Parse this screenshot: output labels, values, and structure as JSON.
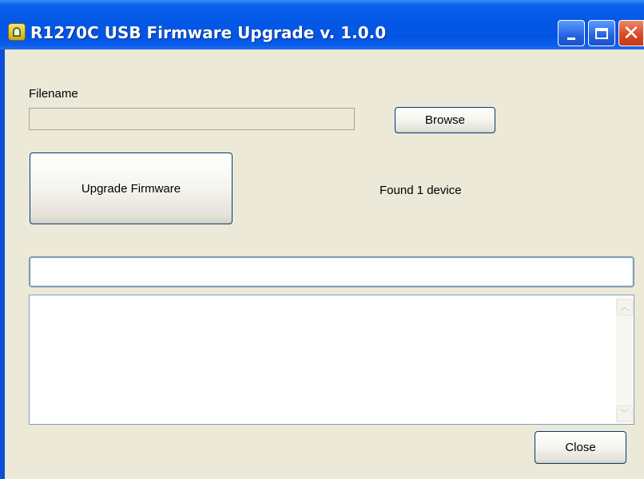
{
  "window": {
    "title": "R1270C USB Firmware Upgrade v. 1.0.0",
    "icon": "app-icon",
    "controls": {
      "minimize": "minimize-icon",
      "maximize": "maximize-icon",
      "close_glyph": "✕"
    }
  },
  "form": {
    "filename_label": "Filename",
    "filename_value": "",
    "browse_label": "Browse",
    "upgrade_label": "Upgrade Firmware",
    "status_text": "Found 1 device",
    "progress_value": 0,
    "log_text": "",
    "close_label": "Close"
  },
  "colors": {
    "titlebar": "#0458e6",
    "client_bg": "#ece9d8",
    "close_button_red": "#d94b25"
  }
}
